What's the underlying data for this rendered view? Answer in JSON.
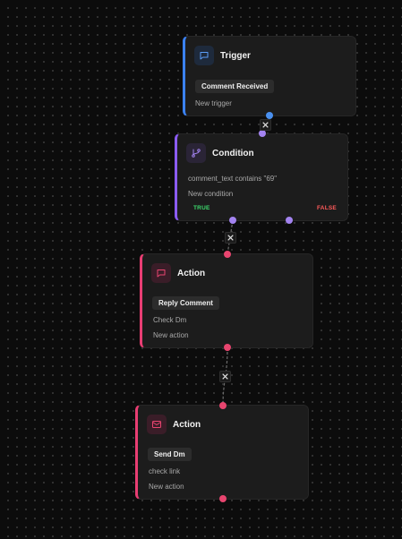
{
  "nodes": {
    "trigger": {
      "title": "Trigger",
      "chip": "Comment Received",
      "subtitle": "New trigger",
      "icon": "chat-bubble-icon",
      "accent": "#3b82f6"
    },
    "condition": {
      "title": "Condition",
      "rule": "comment_text contains \"69\"",
      "subtitle": "New condition",
      "true_label": "TRUE",
      "false_label": "FALSE",
      "icon": "branch-icon",
      "accent": "#8b5cf6"
    },
    "action1": {
      "title": "Action",
      "chip": "Reply Comment",
      "detail": "Check Dm",
      "subtitle": "New action",
      "icon": "chat-bubble-icon",
      "accent": "#e83e73"
    },
    "action2": {
      "title": "Action",
      "chip": "Send Dm",
      "detail": "check link",
      "subtitle": "New action",
      "icon": "mail-icon",
      "accent": "#e83e73"
    }
  },
  "edges": [
    {
      "from": "trigger",
      "to": "condition",
      "delete_icon": "close-icon"
    },
    {
      "from": "condition",
      "to": "action1",
      "delete_icon": "close-icon"
    },
    {
      "from": "action1",
      "to": "action2",
      "delete_icon": "close-icon"
    }
  ]
}
